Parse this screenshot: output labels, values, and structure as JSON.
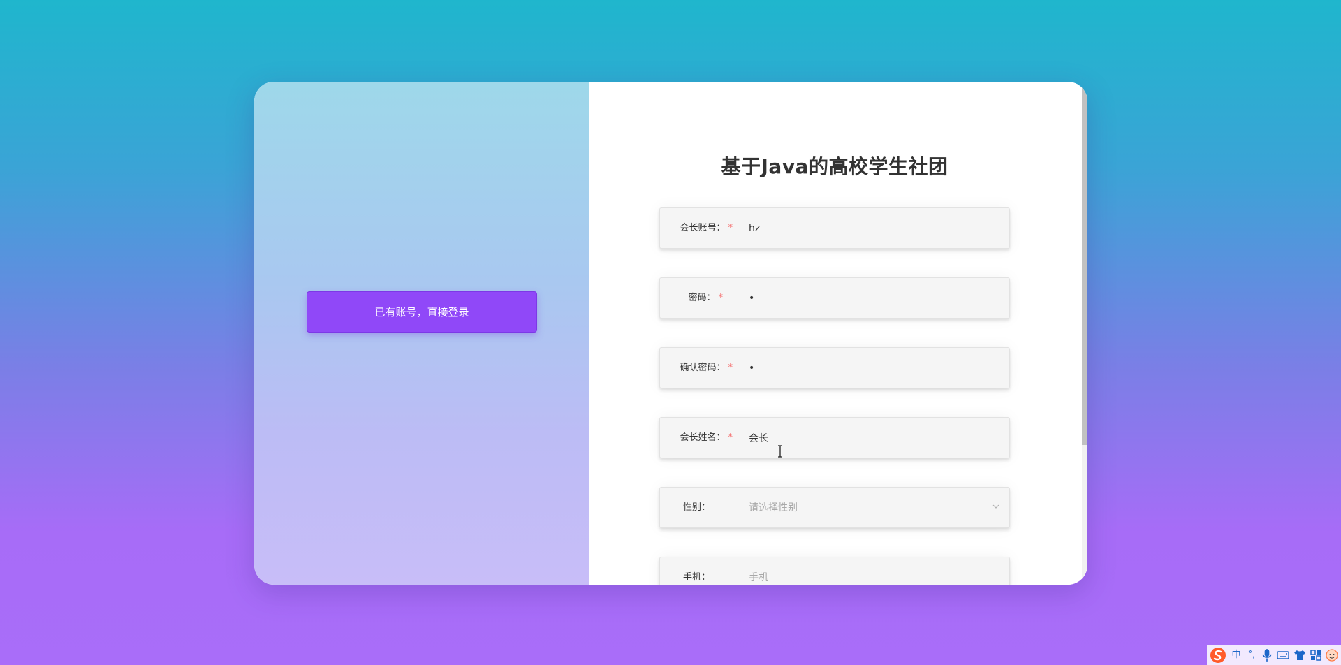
{
  "left_panel": {
    "login_link_label": "已有账号，直接登录"
  },
  "form": {
    "title": "基于Java的高校学生社团",
    "fields": [
      {
        "label": "会长账号：",
        "required": true,
        "value": "hz",
        "placeholder": ""
      },
      {
        "label": "密码：",
        "required": true,
        "value": "•",
        "placeholder": ""
      },
      {
        "label": "确认密码：",
        "required": true,
        "value": "•",
        "placeholder": ""
      },
      {
        "label": "会长姓名：",
        "required": true,
        "value": "会长",
        "placeholder": ""
      },
      {
        "label": "性别：",
        "required": false,
        "value": "",
        "placeholder": "请选择性别"
      },
      {
        "label": "手机：",
        "required": false,
        "value": "",
        "placeholder": "手机"
      }
    ],
    "required_mark": "*"
  },
  "tray": {
    "ime_mode": "中",
    "punct": "°,",
    "icons": [
      "sogou-ime-icon",
      "microphone-icon",
      "keyboard-icon",
      "shirt-icon",
      "grid-icon",
      "avatar-icon"
    ]
  },
  "colors": {
    "accent_button": "#9048f8",
    "required_mark": "#f56c6c",
    "title_text": "#333333"
  }
}
